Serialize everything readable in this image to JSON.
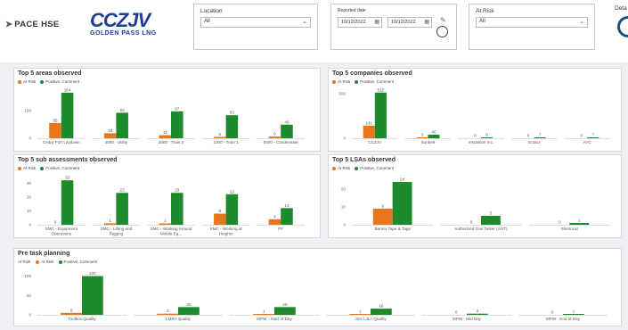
{
  "brand": {
    "pace": "PACE HSE",
    "ccz": "CCZJV",
    "ccz_sub": "GOLDEN PASS LNG"
  },
  "filters": {
    "location": {
      "label": "Location",
      "value": "All"
    },
    "reported_date": {
      "label": "Reported date",
      "from": "10/12/2022",
      "to": "10/12/2022"
    },
    "at_risk": {
      "label": "At Risk",
      "value": "All"
    }
  },
  "details_label": "Deta",
  "colors": {
    "at_risk": "#e8761c",
    "positive": "#1d8a2c"
  },
  "legend": {
    "at_risk": "At Risk",
    "positive": "Positive, Comment",
    "field": "At Risk"
  },
  "chart_data": [
    {
      "id": "areas",
      "type": "bar",
      "title": "Top 5 areas observed",
      "categories": [
        "Cedar Port Laydown",
        "4000 - Utility",
        "2000 - Train 2",
        "1000 - Train 1",
        "5000 - Condensate"
      ],
      "series": [
        {
          "name": "At Risk",
          "values": [
            55,
            18,
            11,
            5,
            6
          ]
        },
        {
          "name": "Positive, Comment",
          "values": [
            164,
            92,
            97,
            83,
            49
          ]
        }
      ],
      "yticks": [
        0,
        100
      ],
      "ylim": [
        0,
        180
      ]
    },
    {
      "id": "companies",
      "type": "bar",
      "title": "Top 5 companies observed",
      "categories": [
        "CCZJV",
        "Sunbelt",
        "Insulation Inc.",
        "Entact",
        "AVC"
      ],
      "series": [
        {
          "name": "At Risk",
          "values": [
            141,
            3,
            0,
            0,
            0
          ]
        },
        {
          "name": "Positive, Comment",
          "values": [
            512,
            40,
            8,
            7,
            7
          ]
        }
      ],
      "yticks": [
        0,
        500
      ],
      "ylim": [
        0,
        560
      ]
    },
    {
      "id": "subassessments",
      "type": "bar",
      "title": "Top 5 sub assessments observed",
      "categories": [
        "SMC - Equipment Operations",
        "SMC - Lifting and Rigging",
        "SMC - Working Around Mobile Eq...",
        "SMC - Working at Heights",
        "PF"
      ],
      "series": [
        {
          "name": "At Risk",
          "values": [
            0,
            1,
            1,
            8,
            4
          ]
        },
        {
          "name": "Positive, Comment",
          "values": [
            32,
            23,
            23,
            22,
            12
          ]
        }
      ],
      "yticks": [
        0,
        10,
        20,
        30
      ],
      "ylim": [
        0,
        36
      ]
    },
    {
      "id": "lsas",
      "type": "bar",
      "title": "Top 5 LSAs observed",
      "categories": [
        "Barrier Tape & Tags",
        "Authorized Gas Tester (AGT)",
        "Electrical"
      ],
      "series": [
        {
          "name": "At Risk",
          "values": [
            9,
            0,
            0
          ]
        },
        {
          "name": "Positive, Comment",
          "values": [
            24,
            5,
            1
          ]
        }
      ],
      "yticks": [
        0,
        10,
        20
      ],
      "ylim": [
        0,
        28
      ]
    },
    {
      "id": "pretask",
      "type": "bar",
      "title": "Pre task planning",
      "categories": [
        "Toolbox Quality",
        "LMRA Quality",
        "MPW - Start of Day",
        "JSA / JLA Quality",
        "MPW - Mid Day",
        "MPW - End of Day"
      ],
      "series": [
        {
          "name": "At Risk",
          "values": [
            5,
            3,
            1,
            1,
            0,
            0
          ]
        },
        {
          "name": "Positive, Comment",
          "values": [
            100,
            20,
            20,
            16,
            3,
            1
          ]
        }
      ],
      "yticks": [
        0,
        50,
        100
      ],
      "ylim": [
        0,
        115
      ]
    }
  ]
}
